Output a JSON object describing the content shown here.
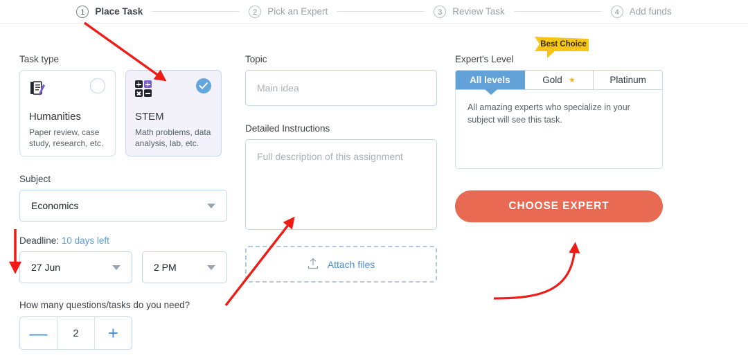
{
  "stepper": {
    "steps": [
      {
        "num": "1",
        "label": "Place Task",
        "active": true
      },
      {
        "num": "2",
        "label": "Pick an Expert",
        "active": false
      },
      {
        "num": "3",
        "label": "Review Task",
        "active": false
      },
      {
        "num": "4",
        "label": "Add funds",
        "active": false
      }
    ]
  },
  "task_type": {
    "label": "Task type",
    "cards": [
      {
        "title": "Humanities",
        "desc": "Paper review, case study, research, etc.",
        "icon": "document-pen-icon",
        "selected": false
      },
      {
        "title": "STEM",
        "desc": "Math problems, data analysis, lab, etc.",
        "icon": "math-operators-icon",
        "selected": true
      }
    ]
  },
  "subject": {
    "label": "Subject",
    "value": "Economics",
    "icon": "chevron-down-icon"
  },
  "deadline": {
    "label": "Deadline:",
    "days_left": "10 days left",
    "date_value": "27 Jun",
    "time_value": "2 PM"
  },
  "quantity": {
    "label": "How many questions/tasks do you need?",
    "minus": "—",
    "value": "2",
    "plus": "+"
  },
  "topic": {
    "label": "Topic",
    "placeholder": "Main idea",
    "value": ""
  },
  "instructions": {
    "label": "Detailed Instructions",
    "placeholder": "Full description of this assignment",
    "value": ""
  },
  "attach": {
    "label": "Attach files",
    "icon": "upload-icon"
  },
  "expert_level": {
    "label": "Expert's Level",
    "badge": "Best Choice",
    "tabs": [
      {
        "label": "All levels",
        "active": true,
        "star": false
      },
      {
        "label": "Gold",
        "active": false,
        "star": true
      },
      {
        "label": "Platinum",
        "active": false,
        "star": false
      }
    ],
    "description": "All amazing experts who specialize in your subject will see this task."
  },
  "cta": {
    "label": "CHOOSE EXPERT"
  },
  "colors": {
    "accent_blue": "#62a0d8",
    "cta_orange": "#e96a52",
    "badge_yellow": "#f5c518",
    "annotation_red": "#ee1c15",
    "purple": "#7b5cd6",
    "border_blue": "#bfd8ee"
  },
  "annotations": [
    {
      "name": "arrow-to-stem-card",
      "type": "arrow-straight"
    },
    {
      "name": "arrow-to-deadline-date",
      "type": "arrow-straight"
    },
    {
      "name": "arrow-to-detailed-instructions",
      "type": "arrow-straight"
    },
    {
      "name": "arrow-to-choose-expert",
      "type": "arrow-curved"
    }
  ]
}
